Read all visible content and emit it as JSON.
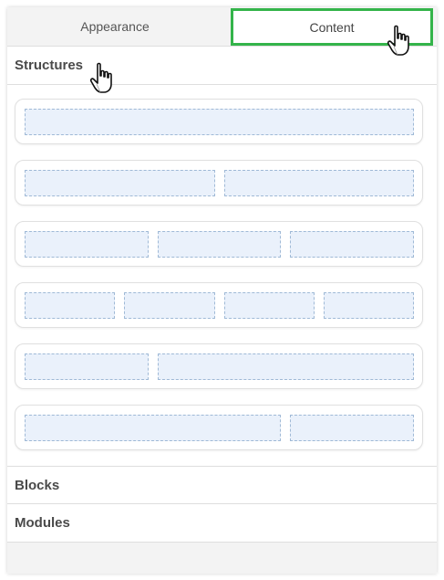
{
  "tabs": [
    {
      "label": "Appearance",
      "active": false
    },
    {
      "label": "Content",
      "active": true
    }
  ],
  "sections": {
    "structures": "Structures",
    "blocks": "Blocks",
    "modules": "Modules"
  },
  "structure_rows": [
    {
      "columns": 1
    },
    {
      "columns": 2
    },
    {
      "columns": 3
    },
    {
      "columns": 4
    },
    {
      "columns": 2
    },
    {
      "columns": 2
    }
  ],
  "colors": {
    "active_tab_border": "#34b44a",
    "column_fill": "#eaf1fb",
    "column_border": "#9fb9d6"
  },
  "icons": {
    "cursor": "hand-pointer-icon"
  }
}
